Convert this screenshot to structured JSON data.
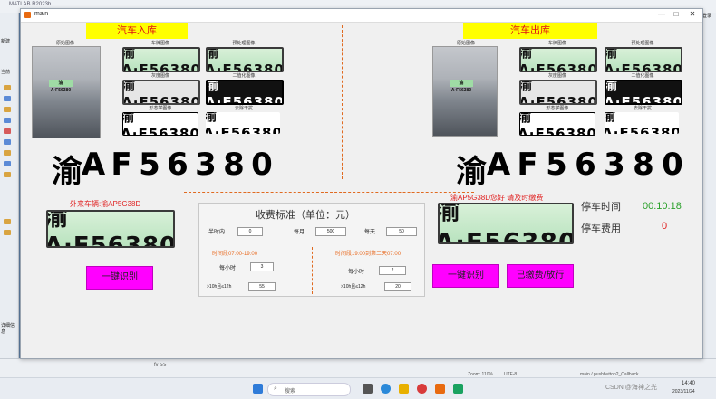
{
  "ide": {
    "title": "MATLAB R2023b",
    "left_label_new": "新建",
    "left_label_current": "当前",
    "left_label_details": "详细信息",
    "right_label": "登录",
    "cmd_prompt": "fx >>",
    "status_zoom": "Zoom: 110%",
    "status_encoding": "UTF-8",
    "status_function": "main / pushbutton2_Callback"
  },
  "window": {
    "title": "main",
    "minimize": "—",
    "maximize": "□",
    "close": "✕"
  },
  "entry": {
    "title": "汽车入库",
    "original_label": "原始图像",
    "plate_text": "渝A·F56380",
    "thumb_labels": [
      "车牌图像",
      "预处理图像",
      "灰度图像",
      "二值化图像",
      "形态学图像",
      "去除干扰"
    ],
    "chars": [
      "渝",
      "A",
      "F",
      "5",
      "6",
      "3",
      "8",
      "0"
    ],
    "external_label": "外来车辆:渝AP5G38D",
    "recognize_button": "一键识别"
  },
  "exit": {
    "title": "汽车出库",
    "original_label": "原始图像",
    "thumb_labels": [
      "车牌图像",
      "预处理图像",
      "灰度图像",
      "二值化图像",
      "形态学图像",
      "去除干扰"
    ],
    "chars": [
      "渝",
      "A",
      "F",
      "5",
      "6",
      "3",
      "8",
      "0"
    ],
    "greeting": "渝AP5G38D您好 请及时缴费",
    "parking_time_label": "停车时间",
    "parking_time_value": "00:10:18",
    "parking_fee_label": "停车费用",
    "parking_fee_value": "0",
    "recognize_button": "一键识别",
    "paid_button": "已缴费/放行"
  },
  "fees": {
    "title": "收费标准（单位：元）",
    "half_hour_label": "半时内",
    "half_hour_value": "0",
    "monthly_label": "每月",
    "monthly_value": "500",
    "daily_label": "每天",
    "daily_value": "50",
    "day_period": "时间段07:00-19:00",
    "night_period": "时间段19:00到第二天07:00",
    "day_hourly_label": "每小时",
    "day_hourly_value": "3",
    "night_hourly_label": "每小时",
    "night_hourly_value": "2",
    "day_cap_label": ">10h且≤12h",
    "day_cap_value": "55",
    "night_cap_label": ">10h且≤12h",
    "night_cap_value": "20"
  },
  "taskbar": {
    "search_placeholder": "搜索",
    "time": "14:40",
    "date": "2023/11/24",
    "watermark": "CSDN @海神之光"
  },
  "colors": {
    "accent_yellow": "#ffff00",
    "title_red": "#e01010",
    "button_magenta": "#ff00ff",
    "time_green": "#2aa02a",
    "fee_red": "#e02020",
    "divider_orange": "#e06a20"
  }
}
